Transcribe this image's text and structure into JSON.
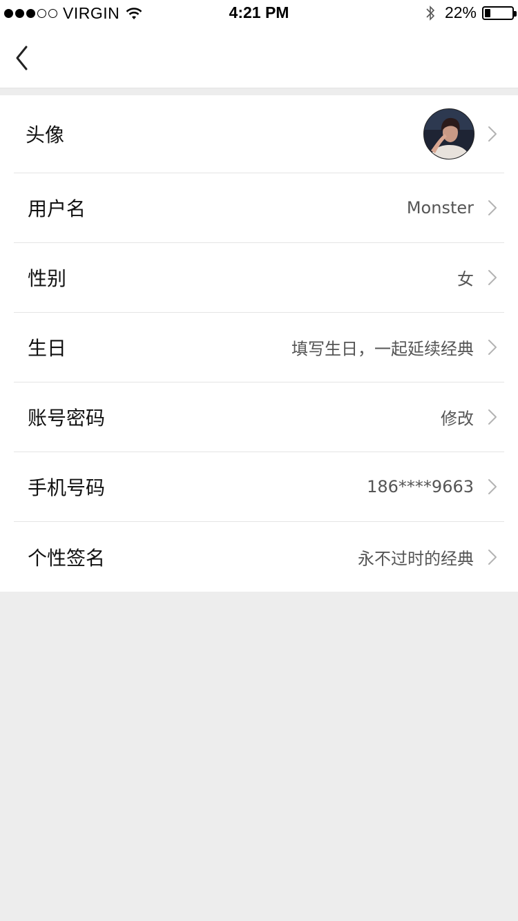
{
  "status_bar": {
    "carrier": "VIRGIN",
    "time": "4:21 PM",
    "battery_percent": "22%",
    "battery_level": 0.22,
    "signal_strength": 3,
    "icons": [
      "signal-dots-icon",
      "wifi-icon",
      "bluetooth-icon",
      "battery-icon"
    ]
  },
  "nav_bar": {
    "back_icon": "chevron-left-icon"
  },
  "profile": {
    "rows": [
      {
        "key": "avatar",
        "label": "头像",
        "value": ""
      },
      {
        "key": "username",
        "label": "用户名",
        "value": "Monster"
      },
      {
        "key": "gender",
        "label": "性别",
        "value": "女"
      },
      {
        "key": "birthday",
        "label": "生日",
        "value": "填写生日，一起延续经典"
      },
      {
        "key": "password",
        "label": "账号密码",
        "value": "修改"
      },
      {
        "key": "phone",
        "label": "手机号码",
        "value": "186****9663"
      },
      {
        "key": "signature",
        "label": "个性签名",
        "value": "永不过时的经典"
      }
    ]
  },
  "colors": {
    "background": "#ededed",
    "surface": "#ffffff",
    "divider": "#e4e4e4",
    "label_text": "#111111",
    "value_text": "#555555",
    "chevron": "#b3b3b3"
  }
}
